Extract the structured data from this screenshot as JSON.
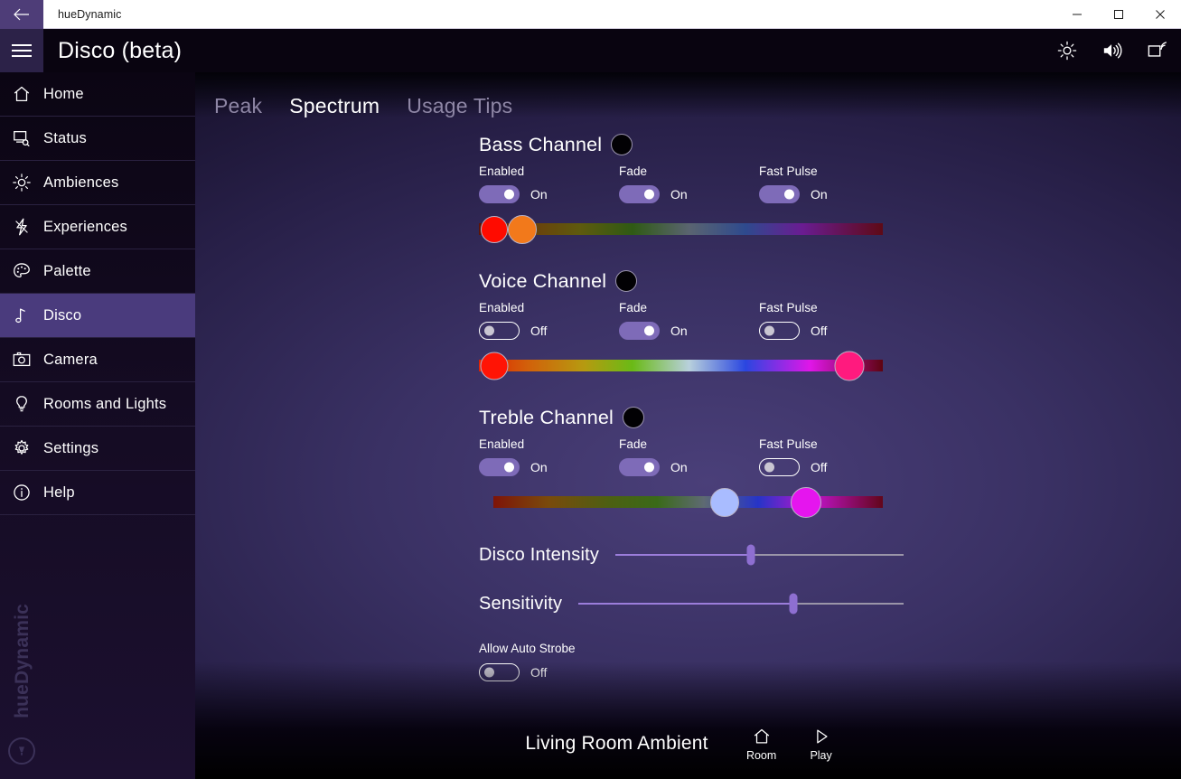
{
  "titlebar": {
    "back_icon": "back-arrow-icon",
    "app_name": "hueDynamic",
    "minimize_label": "–",
    "maximize_label": "□",
    "close_label": "✕"
  },
  "header": {
    "menu_icon": "hamburger-icon",
    "title": "Disco (beta)",
    "actions": [
      {
        "name": "brightness-icon",
        "label": "Brightness"
      },
      {
        "name": "volume-icon",
        "label": "Volume"
      },
      {
        "name": "cast-icon",
        "label": "Cast"
      }
    ]
  },
  "sidebar": {
    "brand": "hueDynamic",
    "brand_logo_icon": "hue-bulb-logo-icon",
    "items": [
      {
        "label": "Home",
        "icon": "home-icon",
        "active": false
      },
      {
        "label": "Status",
        "icon": "status-icon",
        "active": false
      },
      {
        "label": "Ambiences",
        "icon": "sun-icon",
        "active": false
      },
      {
        "label": "Experiences",
        "icon": "bolt-icon",
        "active": false
      },
      {
        "label": "Palette",
        "icon": "palette-icon",
        "active": false
      },
      {
        "label": "Disco",
        "icon": "music-note-icon",
        "active": true
      },
      {
        "label": "Camera",
        "icon": "camera-icon",
        "active": false
      },
      {
        "label": "Rooms and Lights",
        "icon": "bulb-icon",
        "active": false
      },
      {
        "label": "Settings",
        "icon": "gear-icon",
        "active": false
      },
      {
        "label": "Help",
        "icon": "info-icon",
        "active": false
      }
    ]
  },
  "tabs": [
    {
      "label": "Peak",
      "active": false
    },
    {
      "label": "Spectrum",
      "active": true
    },
    {
      "label": "Usage Tips",
      "active": false
    }
  ],
  "channels": [
    {
      "title": "Bass Channel",
      "dot_color": "#020104",
      "controls": [
        {
          "label": "Enabled",
          "state": "On"
        },
        {
          "label": "Fade",
          "state": "On"
        },
        {
          "label": "Fast Pulse",
          "state": "On"
        }
      ],
      "gradient": {
        "brightness": "dim",
        "thumbs": [
          {
            "pos_pct": 3.8,
            "color": "#ff0b00",
            "size": 30
          },
          {
            "pos_pct": 10.8,
            "color": "#f2791b",
            "size": 32
          }
        ]
      }
    },
    {
      "title": "Voice Channel",
      "dot_color": "#020104",
      "controls": [
        {
          "label": "Enabled",
          "state": "Off"
        },
        {
          "label": "Fade",
          "state": "On"
        },
        {
          "label": "Fast Pulse",
          "state": "Off"
        }
      ],
      "gradient": {
        "brightness": "bright",
        "thumbs": [
          {
            "pos_pct": 3.8,
            "color": "#ff1405",
            "size": 31
          },
          {
            "pos_pct": 91.7,
            "color": "#ff1a7e",
            "size": 33
          }
        ]
      }
    },
    {
      "title": "Treble Channel",
      "dot_color": "#020104",
      "controls": [
        {
          "label": "Enabled",
          "state": "On"
        },
        {
          "label": "Fade",
          "state": "On"
        },
        {
          "label": "Fast Pulse",
          "state": "Off"
        }
      ],
      "gradient": {
        "brightness": "mid",
        "thumbs": [
          {
            "pos_pct": 59.3,
            "color": "#a9bcff",
            "size": 32
          },
          {
            "pos_pct": 80.3,
            "color": "#e515ee",
            "size": 34
          }
        ]
      }
    }
  ],
  "sliders": [
    {
      "label": "Disco Intensity",
      "value_pct": 47
    },
    {
      "label": "Sensitivity",
      "value_pct": 66
    }
  ],
  "strobe": {
    "label": "Allow Auto Strobe",
    "state": "Off"
  },
  "bottombar": {
    "now_playing": "Living Room Ambient",
    "room_label": "Room",
    "room_icon": "home-icon",
    "play_label": "Play",
    "play_icon": "play-icon"
  },
  "colors": {
    "accent": "#7e6bb8",
    "active_nav": "#4a3b7d",
    "title_accent": "#4e3d78",
    "slider_fill": "#9b7ddb"
  }
}
